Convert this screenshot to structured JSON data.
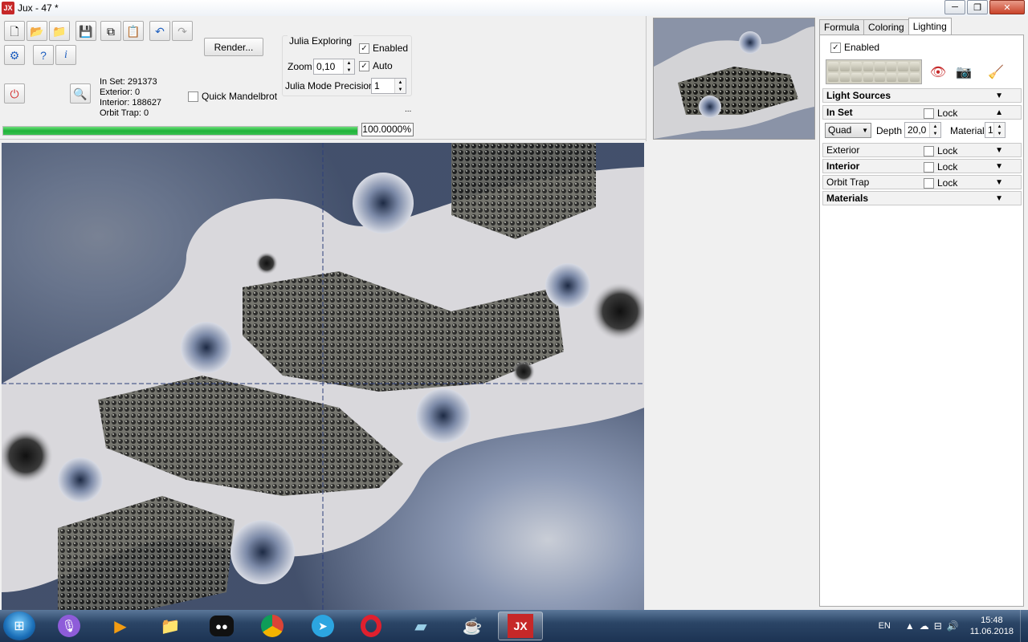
{
  "window": {
    "title": "Jux - 47 *",
    "app_icon_text": "JX",
    "min_label": "─",
    "max_label": "❐",
    "close_label": "✕"
  },
  "toolbar": {
    "render_label": "Render...",
    "quick_mandelbrot_label": "Quick Mandelbrot",
    "quick_mandelbrot_checked": false
  },
  "stats": {
    "in_set": "In Set: 291373",
    "exterior": "Exterior: 0",
    "interior": "Interior: 188627",
    "orbit_trap": "Orbit Trap: 0"
  },
  "julia": {
    "group_label": "Julia Exploring",
    "enabled_label": "Enabled",
    "enabled_checked": true,
    "zoom_label": "Zoom",
    "zoom_value": "0,10",
    "auto_label": "Auto",
    "auto_checked": true,
    "precision_label": "Julia Mode Precision",
    "precision_value": "1",
    "more": "..."
  },
  "progress": {
    "percent_text": "100.0000%",
    "fraction": 1.0,
    "color": "#20b33a"
  },
  "right_panel": {
    "tabs": [
      "Formula",
      "Coloring",
      "Lighting"
    ],
    "active_tab": "Lighting",
    "enabled_label": "Enabled",
    "enabled_checked": true,
    "sections": {
      "light_sources": "Light Sources",
      "in_set": "In Set",
      "exterior": "Exterior",
      "interior": "Interior",
      "orbit_trap": "Orbit Trap",
      "materials": "Materials"
    },
    "lock_label": "Lock",
    "in_set_row": {
      "type": "Quad",
      "depth_label": "Depth",
      "depth_value": "20,0",
      "material_label": "Material",
      "material_value": "1"
    }
  },
  "taskbar": {
    "lang": "EN",
    "time": "15:48",
    "date": "11.06.2018",
    "icons": [
      "windows-start",
      "voice-assistant",
      "media-player",
      "file-explorer",
      "panda-app",
      "chrome",
      "telegram",
      "opera",
      "notes-app",
      "java",
      "jux"
    ]
  }
}
